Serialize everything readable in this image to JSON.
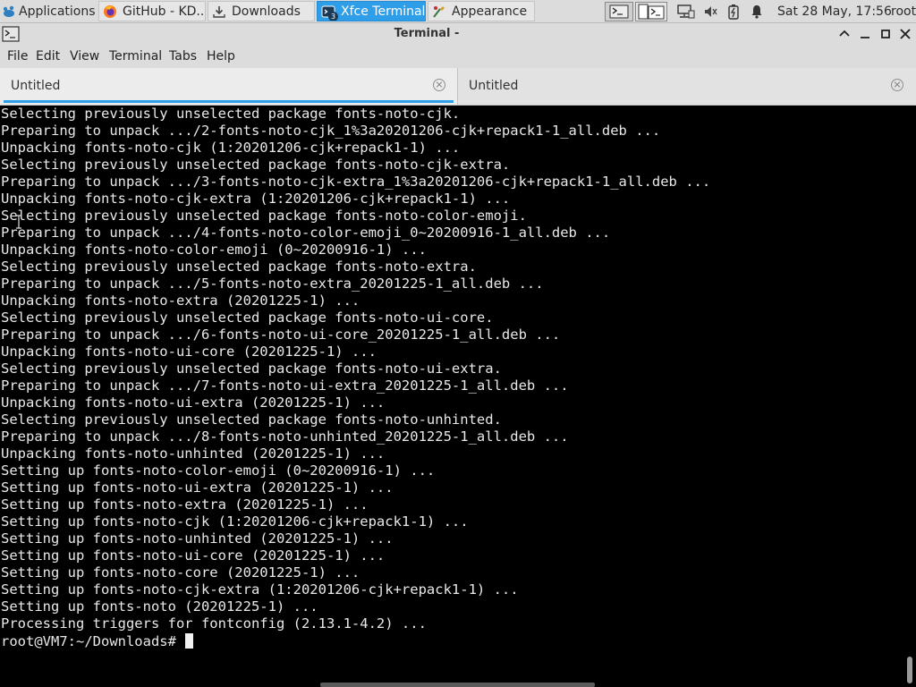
{
  "panel": {
    "applications_label": "Applications",
    "tasks": [
      {
        "label": "GitHub - KD...",
        "icon": "firefox-icon"
      },
      {
        "label": "Downloads",
        "icon": "downloads-icon"
      },
      {
        "label": "Xfce Terminal",
        "icon": "terminal-icon",
        "badge": "3",
        "active": true
      },
      {
        "label": "Appearance",
        "icon": "appearance-icon"
      }
    ],
    "clock": "Sat 28 May, 17:56",
    "user": "root",
    "accent_color": "#2f9ee8"
  },
  "window": {
    "title": "Terminal -"
  },
  "menubar": {
    "items": [
      "File",
      "Edit",
      "View",
      "Terminal",
      "Tabs",
      "Help"
    ]
  },
  "tabs": [
    {
      "label": "Untitled",
      "selected": true
    },
    {
      "label": "Untitled",
      "selected": false
    }
  ],
  "terminal": {
    "lines": [
      "Selecting previously unselected package fonts-noto-cjk.",
      "Preparing to unpack .../2-fonts-noto-cjk_1%3a20201206-cjk+repack1-1_all.deb ...",
      "Unpacking fonts-noto-cjk (1:20201206-cjk+repack1-1) ...",
      "Selecting previously unselected package fonts-noto-cjk-extra.",
      "Preparing to unpack .../3-fonts-noto-cjk-extra_1%3a20201206-cjk+repack1-1_all.deb ...",
      "Unpacking fonts-noto-cjk-extra (1:20201206-cjk+repack1-1) ...",
      "Selecting previously unselected package fonts-noto-color-emoji.",
      "Preparing to unpack .../4-fonts-noto-color-emoji_0~20200916-1_all.deb ...",
      "Unpacking fonts-noto-color-emoji (0~20200916-1) ...",
      "Selecting previously unselected package fonts-noto-extra.",
      "Preparing to unpack .../5-fonts-noto-extra_20201225-1_all.deb ...",
      "Unpacking fonts-noto-extra (20201225-1) ...",
      "Selecting previously unselected package fonts-noto-ui-core.",
      "Preparing to unpack .../6-fonts-noto-ui-core_20201225-1_all.deb ...",
      "Unpacking fonts-noto-ui-core (20201225-1) ...",
      "Selecting previously unselected package fonts-noto-ui-extra.",
      "Preparing to unpack .../7-fonts-noto-ui-extra_20201225-1_all.deb ...",
      "Unpacking fonts-noto-ui-extra (20201225-1) ...",
      "Selecting previously unselected package fonts-noto-unhinted.",
      "Preparing to unpack .../8-fonts-noto-unhinted_20201225-1_all.deb ...",
      "Unpacking fonts-noto-unhinted (20201225-1) ...",
      "Setting up fonts-noto-color-emoji (0~20200916-1) ...",
      "Setting up fonts-noto-ui-extra (20201225-1) ...",
      "Setting up fonts-noto-extra (20201225-1) ...",
      "Setting up fonts-noto-cjk (1:20201206-cjk+repack1-1) ...",
      "Setting up fonts-noto-unhinted (20201225-1) ...",
      "Setting up fonts-noto-ui-core (20201225-1) ...",
      "Setting up fonts-noto-core (20201225-1) ...",
      "Setting up fonts-noto-cjk-extra (1:20201206-cjk+repack1-1) ...",
      "Setting up fonts-noto (20201225-1) ...",
      "Processing triggers for fontconfig (2.13.1-4.2) ..."
    ],
    "prompt": "root@VM7:~/Downloads# "
  }
}
